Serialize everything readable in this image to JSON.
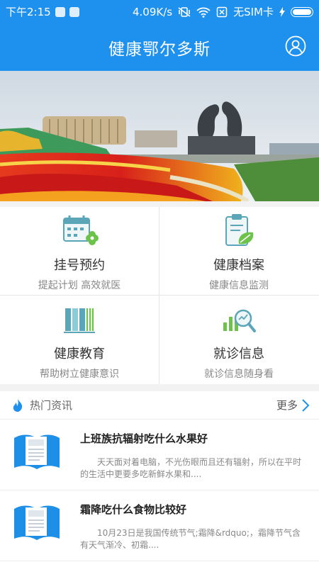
{
  "status_bar": {
    "time": "下午2:15",
    "network_speed": "4.09K/s",
    "sim_status": "无SIM卡"
  },
  "header": {
    "title": "健康鄂尔多斯",
    "color": "#1e90ee"
  },
  "grid": [
    {
      "title": "挂号预约",
      "subtitle": "提起计划 高效就医",
      "icon": "calendar-icon"
    },
    {
      "title": "健康档案",
      "subtitle": "健康信息监测",
      "icon": "clipboard-leaf-icon"
    },
    {
      "title": "健康教育",
      "subtitle": "帮助树立健康意识",
      "icon": "books-icon"
    },
    {
      "title": "就诊信息",
      "subtitle": "就诊信息随身看",
      "icon": "chart-magnifier-icon"
    }
  ],
  "news": {
    "section_title": "热门资讯",
    "more_label": "更多",
    "items": [
      {
        "title": "上班族抗辐射吃什么水果好",
        "desc": "天天面对着电脑，不光伤眼而且还有辐射，所以在平时的生活中更要多吃新鲜水果和...."
      },
      {
        "title": "霜降吃什么食物比较好",
        "desc": "10月23日是我国传统节气;霜降&rdquo;，霜降节气含有天气渐冷、初霜...."
      }
    ]
  }
}
